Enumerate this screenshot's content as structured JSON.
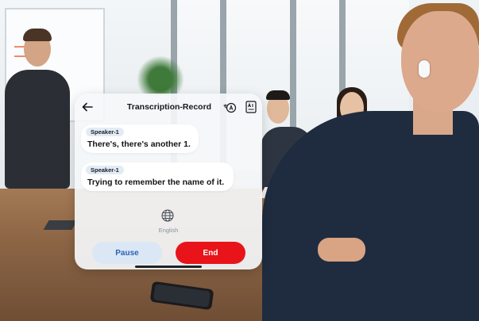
{
  "header": {
    "title": "Transcription-Record"
  },
  "transcript": [
    {
      "speaker": "Speaker-1",
      "text": "There's, there's another 1."
    },
    {
      "speaker": "Speaker-1",
      "text": "Trying to remember the name of it."
    }
  ],
  "language": {
    "label": "English"
  },
  "controls": {
    "pause_label": "Pause",
    "end_label": "End"
  },
  "icons": {
    "back": "arrow-left-icon",
    "translate": "translate-icon",
    "ai": "ai-document-icon",
    "language": "globe-icon"
  },
  "colors": {
    "end_button": "#e8141a",
    "pause_button_bg": "#dbe7f5",
    "pause_button_text": "#2c63b6",
    "speaker_tag_bg": "#e3ebf5"
  }
}
